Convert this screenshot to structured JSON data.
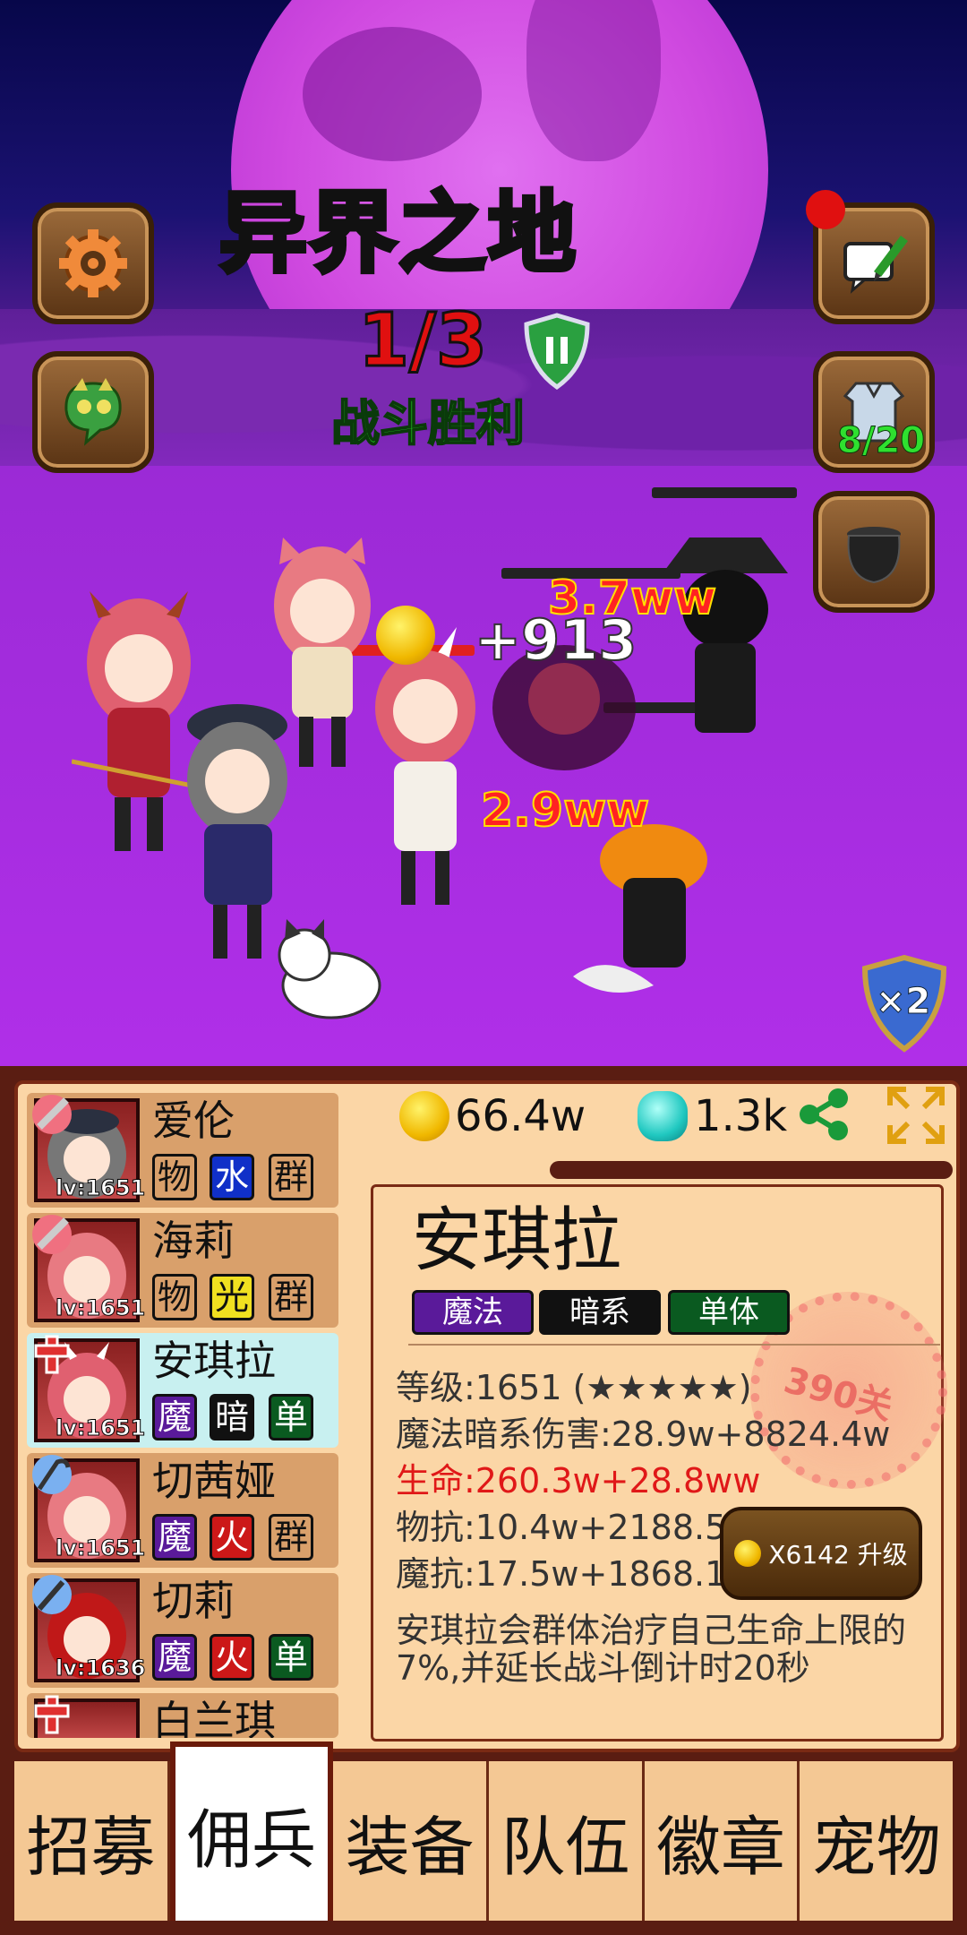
{
  "stage": {
    "title": "异界之地",
    "progress": "1/3",
    "status": "战斗胜利",
    "armor_count": "8/20",
    "speed_label": "×2"
  },
  "battle": {
    "floating_numbers": [
      "3.7ww",
      "+913",
      "2.9ww"
    ]
  },
  "currency": {
    "gold": "66.4w",
    "gems": "1.3k"
  },
  "mercenaries": [
    {
      "name": "爱伦",
      "level": "lv:1651",
      "tags": [
        "物",
        "水",
        "群"
      ]
    },
    {
      "name": "海莉",
      "level": "lv:1651",
      "tags": [
        "物",
        "光",
        "群"
      ]
    },
    {
      "name": "安琪拉",
      "level": "lv:1651",
      "tags": [
        "魔",
        "暗",
        "单"
      ]
    },
    {
      "name": "切茜娅",
      "level": "lv:1651",
      "tags": [
        "魔",
        "火",
        "群"
      ]
    },
    {
      "name": "切莉",
      "level": "lv:1636",
      "tags": [
        "魔",
        "火",
        "单"
      ]
    },
    {
      "name": "白兰琪",
      "level": "",
      "tags": []
    }
  ],
  "detail": {
    "name": "安琪拉",
    "tags": [
      "魔法",
      "暗系",
      "单体"
    ],
    "level": "等级:1651 (★★★★★)",
    "damage": "魔法暗系伤害:28.9w+8824.4w",
    "hp": "生命:260.3w+28.8ww",
    "phys_def": "物抗:10.4w+2188.5w",
    "magic_def": "魔抗:17.5w+1868.1w",
    "stamp": "390关",
    "upgrade_label": "X6142 升级",
    "description": "安琪拉会群体治疗自己生命上限的7%,并延长战斗倒计时20秒"
  },
  "tabs": [
    "招募",
    "佣兵",
    "装备",
    "队伍",
    "徽章",
    "宠物"
  ],
  "colors": {
    "tag_red": "#cc1818",
    "tag_blue": "#1030c8",
    "tag_yellow": "#f0e020",
    "tag_purple": "#5a1a9a",
    "tag_black": "#111111",
    "tag_green": "#0a5a20"
  }
}
